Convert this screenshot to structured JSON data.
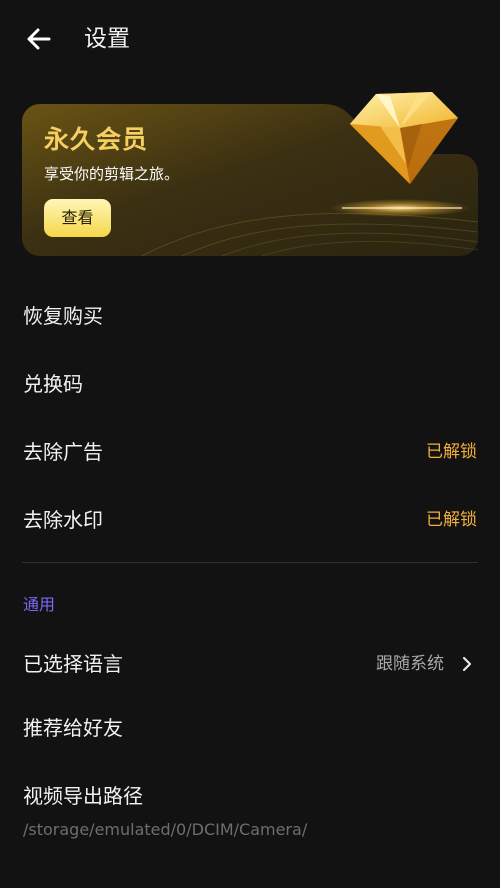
{
  "header": {
    "title": "设置",
    "back_icon": "arrow-left-icon"
  },
  "vip": {
    "title": "永久会员",
    "subtitle": "享受你的剪辑之旅。",
    "button_label": "查看",
    "icon": "diamond-icon",
    "accent": "#f6cf62"
  },
  "items": [
    {
      "label": "恢复购买"
    },
    {
      "label": "兑换码"
    },
    {
      "label": "去除广告",
      "status": "已解锁"
    },
    {
      "label": "去除水印",
      "status": "已解锁"
    }
  ],
  "general": {
    "section_title": "通用",
    "language": {
      "label": "已选择语言",
      "value": "跟随系统",
      "icon": "chevron-right-icon"
    },
    "recommend": {
      "label": "推荐给好友"
    },
    "export_path": {
      "label": "视频导出路径",
      "path": "/storage/emulated/0/DCIM/Camera/"
    }
  },
  "colors": {
    "background": "#121212",
    "unlocked": "#f2ae3b",
    "section": "#7a69f5"
  }
}
